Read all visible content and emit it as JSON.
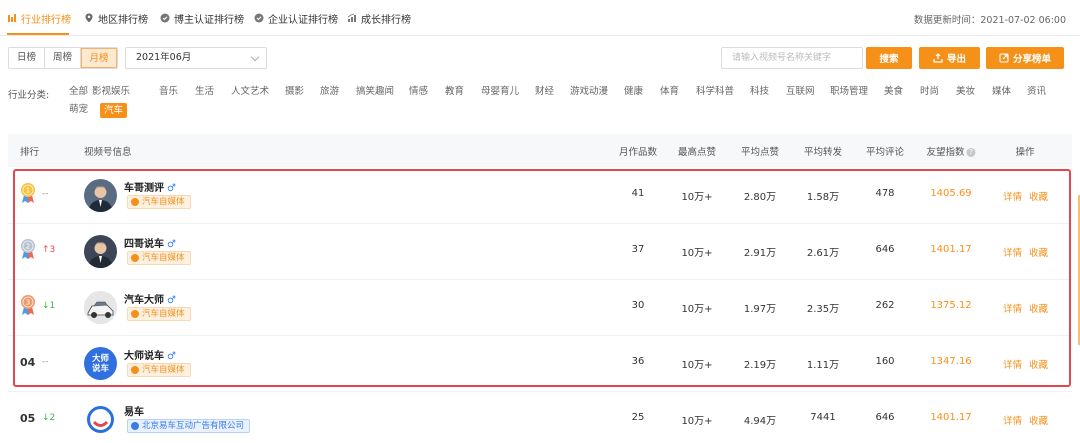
{
  "tabs": [
    {
      "label": "行业排行榜",
      "icon": "bar-chart-icon",
      "active": true
    },
    {
      "label": "地区排行榜",
      "icon": "location-pin-icon",
      "active": false
    },
    {
      "label": "博主认证排行榜",
      "icon": "verified-badge-icon",
      "active": false
    },
    {
      "label": "企业认证排行榜",
      "icon": "verified-badge-icon",
      "active": false
    },
    {
      "label": "成长排行榜",
      "icon": "growth-chart-icon",
      "active": false
    }
  ],
  "update_time": "数据更新时间：2021-07-02 06:00",
  "period": {
    "options": [
      "日榜",
      "周榜",
      "月榜"
    ],
    "selected": "月榜"
  },
  "month_select": {
    "value": "2021年06月"
  },
  "search": {
    "placeholder": "请输入视频号名称关键字",
    "button_label": "搜索"
  },
  "toolbar": {
    "export_label": "导出",
    "share_label": "分享榜单"
  },
  "categories": {
    "label": "行业分类:",
    "row1": [
      "全部",
      "影视娱乐",
      "音乐",
      "生活",
      "人文艺术",
      "摄影",
      "旅游",
      "搞笑趣闻",
      "情感",
      "教育",
      "母婴育儿",
      "财经",
      "游戏动漫",
      "健康",
      "体育",
      "科学科普",
      "科技",
      "互联网",
      "职场管理",
      "美食",
      "时尚",
      "美妆",
      "媒体",
      "资讯"
    ],
    "row2": [
      "萌宠",
      "汽车"
    ],
    "selected": "汽车"
  },
  "table": {
    "headers": {
      "rank": "排行",
      "info": "视频号信息",
      "monthly_works": "月作品数",
      "max_likes": "最高点赞",
      "avg_likes": "平均点赞",
      "avg_shares": "平均转发",
      "avg_comments": "平均评论",
      "index": "友望指数",
      "actions": "操作"
    },
    "rows": [
      {
        "rank": "1",
        "medal": "gold",
        "trend": "--",
        "trend_dir": "flat",
        "name": "车哥测评",
        "gender": "♂",
        "tag": "汽车自媒体",
        "tag_type": "orange",
        "monthly_works": "41",
        "max_likes": "10万+",
        "avg_likes": "2.80万",
        "avg_shares": "1.58万",
        "avg_comments": "478",
        "index": "1405.69",
        "detail": "详情",
        "favorite": "收藏"
      },
      {
        "rank": "2",
        "medal": "silver",
        "trend": "↑3",
        "trend_dir": "up",
        "name": "四哥说车",
        "gender": "♂",
        "tag": "汽车自媒体",
        "tag_type": "orange",
        "monthly_works": "37",
        "max_likes": "10万+",
        "avg_likes": "2.91万",
        "avg_shares": "2.61万",
        "avg_comments": "646",
        "index": "1401.17",
        "detail": "详情",
        "favorite": "收藏"
      },
      {
        "rank": "3",
        "medal": "bronze",
        "trend": "↓1",
        "trend_dir": "down",
        "name": "汽车大师",
        "gender": "♂",
        "tag": "汽车自媒体",
        "tag_type": "orange",
        "monthly_works": "30",
        "max_likes": "10万+",
        "avg_likes": "1.97万",
        "avg_shares": "2.35万",
        "avg_comments": "262",
        "index": "1375.12",
        "detail": "详情",
        "favorite": "收藏"
      },
      {
        "rank": "04",
        "medal": "",
        "trend": "--",
        "trend_dir": "flat",
        "name": "大师说车",
        "gender": "♂",
        "avatar_text": "大师\n说车",
        "tag": "汽车自媒体",
        "tag_type": "orange",
        "monthly_works": "36",
        "max_likes": "10万+",
        "avg_likes": "2.19万",
        "avg_shares": "1.11万",
        "avg_comments": "160",
        "index": "1347.16",
        "detail": "详情",
        "favorite": "收藏"
      },
      {
        "rank": "05",
        "medal": "",
        "trend": "↓2",
        "trend_dir": "down",
        "name": "易车",
        "gender": "",
        "tag": "北京易车互动广告有限公司",
        "tag_type": "blue",
        "monthly_works": "25",
        "max_likes": "10万+",
        "avg_likes": "4.94万",
        "avg_shares": "7441",
        "avg_comments": "646",
        "index": "1401.17",
        "detail": "详情",
        "favorite": "收藏"
      }
    ]
  },
  "colors": {
    "accent": "#f59019",
    "highlight_border": "#e2474b",
    "up": "#e84a4a",
    "down": "#3bb54a",
    "male": "#3b82f6"
  }
}
